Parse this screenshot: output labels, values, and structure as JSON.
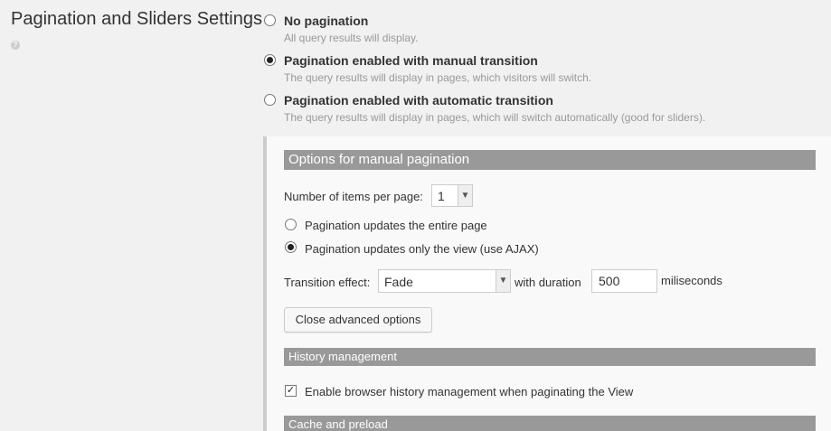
{
  "section": {
    "title": "Pagination and Sliders Settings",
    "help_icon": "?"
  },
  "pagination_options": [
    {
      "label": "No pagination",
      "desc": "All query results will display.",
      "checked": false
    },
    {
      "label": "Pagination enabled with manual transition",
      "desc": "The query results will display in pages, which visitors will switch.",
      "checked": true
    },
    {
      "label": "Pagination enabled with automatic transition",
      "desc": "The query results will display in pages, which will switch automatically (good for sliders).",
      "checked": false
    }
  ],
  "manual": {
    "header": "Options for manual pagination",
    "items_per_page_label": "Number of items per page:",
    "items_per_page_value": "1",
    "update_options": [
      {
        "label": "Pagination updates the entire page",
        "checked": false
      },
      {
        "label": "Pagination updates only the view (use AJAX)",
        "checked": true
      }
    ],
    "transition_label": "Transition effect:",
    "transition_value": "Fade",
    "duration_label": "with duration",
    "duration_value": "500",
    "duration_unit": "miliseconds",
    "close_button": "Close advanced options"
  },
  "history": {
    "header": "History management",
    "checkbox_label": "Enable browser history management when paginating the View",
    "checked": true
  },
  "cache": {
    "header": "Cache and preload"
  }
}
